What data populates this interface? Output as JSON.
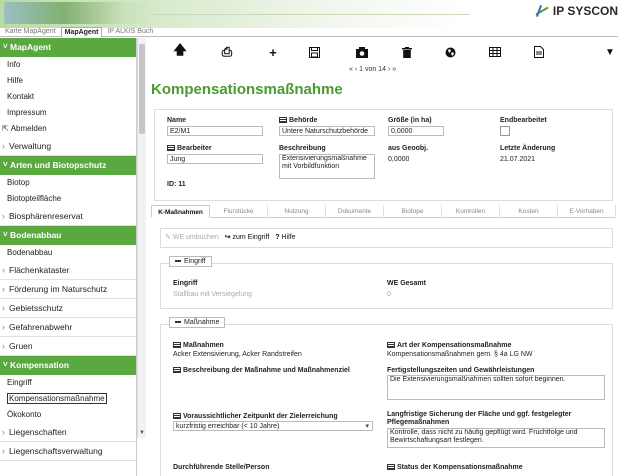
{
  "brand": {
    "name": "IP SYSCON"
  },
  "top_tabs": [
    "Karte MapAgent",
    "MapAgent",
    "IP ALKIS Buch"
  ],
  "sidebar": {
    "mapagent_header": "MapAgent",
    "mapagent_items": [
      "Info",
      "Hilfe",
      "Kontakt",
      "Impressum"
    ],
    "abmelden": "Abmelden",
    "verwaltung": "Verwaltung",
    "arten_header": "Arten und Biotopschutz",
    "arten_items": [
      "Biotop",
      "Biotopteilfläche"
    ],
    "biosphaere": "Biosphärenreservat",
    "bodenabbau_header": "Bodenabbau",
    "bodenabbau_items": [
      "Bodenabbau"
    ],
    "cats_a": [
      "Flächenkataster",
      "Förderung im Naturschutz",
      "Gebietsschutz",
      "Gefahrenabwehr",
      "Gruen"
    ],
    "kompensation_header": "Kompensation",
    "kompensation_items": [
      "Eingriff",
      "Kompensationsmaßnahme",
      "Ökokonto"
    ],
    "cats_b": [
      "Liegenschaften",
      "Liegenschaftsverwaltung"
    ]
  },
  "toolbar": {
    "icons": [
      "arrow-up-icon",
      "print-icon",
      "plus-icon",
      "save-icon",
      "camera-icon",
      "trash-icon",
      "globe-icon",
      "table-icon",
      "document-icon",
      "filter-icon"
    ]
  },
  "pager": {
    "text": "«   ‹ 1 von 14 ›   »"
  },
  "page_title": "Kompensationsmaßnahme",
  "form": {
    "name_label": "Name",
    "name_value": "E2/M1",
    "behoerde_label": "Behörde",
    "behoerde_value": "Untere Naturschutzbehörde",
    "groesse_label": "Größe (in ha)",
    "groesse_value": "0,0000",
    "endbearbeitet_label": "Endbearbeitet",
    "bearbeiter_label": "Bearbeiter",
    "bearbeiter_value": "Jung",
    "beschreibung_label": "Beschreibung",
    "beschreibung_value": "Extensivierungsmaßnahme mit Vorbildfunktion",
    "geoobj_label": "aus Geoobj.",
    "geoobj_value": "0,0000",
    "aenderung_label": "Letzte Änderung",
    "aenderung_value": "21.07.2021",
    "id_text": "ID: 11"
  },
  "content_tabs": [
    "K-Maßnahmen",
    "Flurstücke",
    "Nutzung",
    "Dokumente",
    "Biotope",
    "Kontrollen",
    "Kosten",
    "E-Vorhaben"
  ],
  "actions": {
    "umbuchen": "WE umbuchen",
    "zum_eingriff": "zum Eingriff",
    "hilfe": "Hilfe"
  },
  "eingriff_section": {
    "tag": "Eingriff",
    "eingriff_label": "Eingriff",
    "eingriff_value": "Stallbau mit Versiegelung",
    "we_label": "WE Gesamt",
    "we_value": "0"
  },
  "massnahme_section": {
    "tag": "Maßnahme",
    "massnahmen_label": "Maßnahmen",
    "massnahmen_value": "Acker Extensivierung, Acker Randstreifen",
    "art_label": "Art der Kompensationsmaßnahme",
    "art_value": "Kompensationsmaßnahmen gem. § 4a LG NW",
    "beschr_label": "Beschreibung der Maßnahme und Maßnahmenziel",
    "fertig_label": "Fertigstellungszeiten und Gewährleistungen",
    "fertig_value": "Die Extensivierungsmaßnahmen sollten sofort beginnen.",
    "zeitpunkt_label": "Voraussichtlicher Zeitpunkt der Zielerreichung",
    "zeitpunkt_value": "kurzfristig erreichbar (< 10 Jahre)",
    "sicherung_label": "Langfristige Sicherung der Fläche und ggf. festgelegter Pflegemaßnahmen",
    "sicherung_value": "Kontrolle, dass nicht zu häufig gepflügt wird. Fruchtfolge und Bewirtschaftungsart festlegen.",
    "stelle_label": "Durchführende Stelle/Person",
    "status_label": "Status der Kompensationsmaßnahme"
  }
}
